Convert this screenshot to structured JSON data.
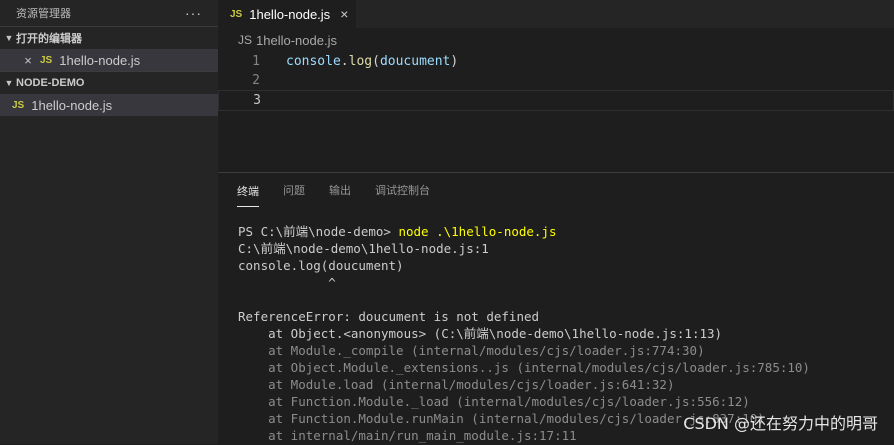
{
  "sidebar": {
    "title": "资源管理器",
    "more_glyph": "···",
    "open_editors": {
      "label": "打开的编辑器",
      "items": [
        {
          "close_glyph": "×",
          "badge": "JS",
          "name": "1hello-node.js"
        }
      ]
    },
    "project": {
      "label": "NODE-DEMO",
      "items": [
        {
          "badge": "JS",
          "name": "1hello-node.js"
        }
      ]
    }
  },
  "editor": {
    "tab": {
      "badge": "JS",
      "name": "1hello-node.js",
      "close_glyph": "×"
    },
    "breadcrumb": {
      "badge": "JS",
      "name": "1hello-node.js"
    },
    "lines": [
      {
        "num": "1",
        "obj": "console",
        "dot": ".",
        "fn": "log",
        "open": "(",
        "arg": "doucument",
        "close": ")"
      },
      {
        "num": "2"
      },
      {
        "num": "3"
      }
    ]
  },
  "panel": {
    "tabs": [
      "终端",
      "问题",
      "输出",
      "调试控制台"
    ],
    "terminal": {
      "prompt": "PS C:\\前端\\node-demo> ",
      "command": "node .\\1hello-node.js",
      "lines": [
        "C:\\前端\\node-demo\\1hello-node.js:1",
        "console.log(doucument)",
        "            ^",
        "",
        "ReferenceError: doucument is not defined",
        "    at Object.<anonymous> (C:\\前端\\node-demo\\1hello-node.js:1:13)"
      ],
      "dim_lines": [
        "    at Module._compile (internal/modules/cjs/loader.js:774:30)",
        "    at Object.Module._extensions..js (internal/modules/cjs/loader.js:785:10)",
        "    at Module.load (internal/modules/cjs/loader.js:641:32)",
        "    at Function.Module._load (internal/modules/cjs/loader.js:556:12)",
        "    at Function.Module.runMain (internal/modules/cjs/loader.js:837:10)",
        "    at internal/main/run_main_module.js:17:11"
      ]
    }
  },
  "watermark": "CSDN @还在努力中的明哥",
  "colors": {
    "js_badge": "#cbcb41",
    "command": "#ffff00",
    "background": "#1e1e1e"
  }
}
